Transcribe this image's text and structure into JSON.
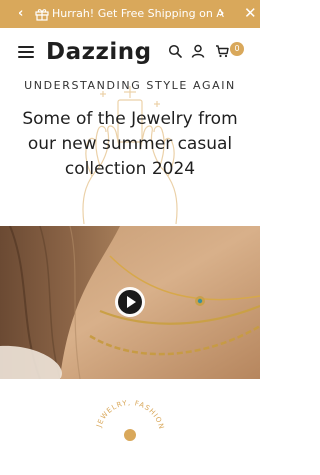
{
  "announcement": {
    "text": "Hurrah! Get Free Shipping on All O...",
    "prev_icon": "chevron-left-icon",
    "next_icon": "chevron-right-icon",
    "gift_icon": "gift-icon",
    "close_icon": "close-icon"
  },
  "header": {
    "logo": "Dazzing",
    "cart_count": "0",
    "icons": [
      "menu-icon",
      "search-icon",
      "user-icon",
      "cart-icon"
    ]
  },
  "hero": {
    "eyebrow": "UNDERSTANDING STYLE AGAIN",
    "headline": "Some of the Jewelry from our new summer casual collection 2024"
  },
  "video": {
    "play_icon": "play-icon"
  },
  "badge": {
    "text": "JEWELRY, FASHION"
  },
  "colors": {
    "accent": "#d9a85b",
    "text": "#1f1f1f",
    "announce_text": "#ffffff"
  }
}
